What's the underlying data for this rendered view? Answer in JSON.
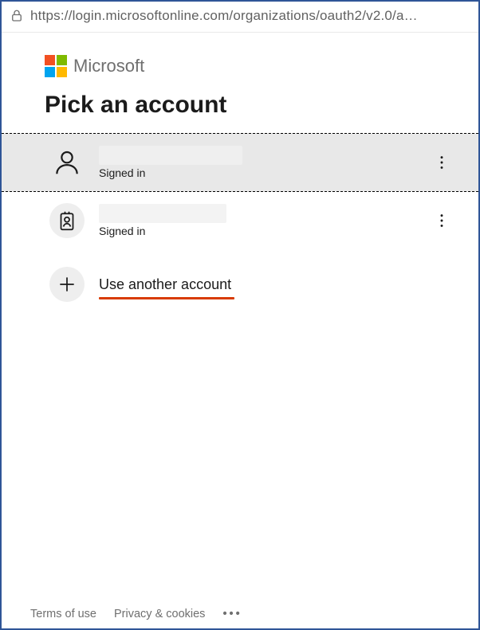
{
  "address_bar": {
    "url": "https://login.microsoftonline.com/organizations/oauth2/v2.0/a…"
  },
  "brand": {
    "name": "Microsoft"
  },
  "page": {
    "title": "Pick an account"
  },
  "accounts": [
    {
      "status": "Signed in",
      "icon": "person-icon",
      "selected": true
    },
    {
      "status": "Signed in",
      "icon": "id-badge-icon",
      "selected": false
    }
  ],
  "another": {
    "label": "Use another account"
  },
  "footer": {
    "terms": "Terms of use",
    "privacy": "Privacy & cookies"
  }
}
